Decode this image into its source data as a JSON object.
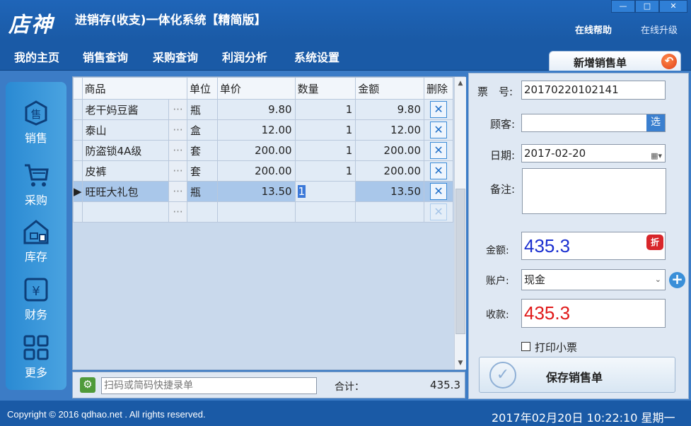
{
  "app": {
    "logo": "店神",
    "title": "进销存(收支)一体化系统【精简版】",
    "help": "在线帮助",
    "upgrade": "在线升级",
    "window_controls": {
      "minimize": "—",
      "maximize": "□",
      "close": "✕"
    }
  },
  "menu": [
    "我的主页",
    "销售查询",
    "采购查询",
    "利润分析",
    "系统设置"
  ],
  "page_tab": {
    "label": "新增销售单",
    "back_icon": "back-arrow-icon"
  },
  "sidebar": [
    {
      "label": "销售",
      "icon": "sales-icon"
    },
    {
      "label": "采购",
      "icon": "cart-icon"
    },
    {
      "label": "库存",
      "icon": "warehouse-icon"
    },
    {
      "label": "财务",
      "icon": "finance-icon"
    },
    {
      "label": "更多",
      "icon": "grid-icon"
    }
  ],
  "grid": {
    "columns": [
      "商品",
      "单位",
      "单价",
      "数量",
      "金额",
      "删除"
    ],
    "rows": [
      {
        "name": "老干妈豆酱",
        "unit": "瓶",
        "price": "9.80",
        "qty": "1",
        "amount": "9.80"
      },
      {
        "name": "泰山",
        "unit": "盒",
        "price": "12.00",
        "qty": "1",
        "amount": "12.00"
      },
      {
        "name": "防盗锁4A级",
        "unit": "套",
        "price": "200.00",
        "qty": "1",
        "amount": "200.00"
      },
      {
        "name": "皮裤",
        "unit": "套",
        "price": "200.00",
        "qty": "1",
        "amount": "200.00"
      },
      {
        "name": "旺旺大礼包",
        "unit": "瓶",
        "price": "13.50",
        "qty": "1",
        "amount": "13.50"
      }
    ],
    "selected_row": 4
  },
  "footer": {
    "scan_placeholder": "扫码或简码快捷录单",
    "total_label": "合计：",
    "total_value": "435.3"
  },
  "form": {
    "ticket_label": "票　号:",
    "ticket_value": "20170220102141",
    "customer_label": "顾客:",
    "customer_value": "",
    "pick_label": "选",
    "date_label": "日期:",
    "date_value": "2017-02-20",
    "note_label": "备注:",
    "amount_label": "金额:",
    "amount_value": "435.3",
    "discount_label": "折",
    "account_label": "账户:",
    "account_value": "现金",
    "receive_label": "收款:",
    "receive_value": "435.3",
    "print_label": "打印小票",
    "save_label": "保存销售单",
    "colors": {
      "amount": "#1a2fd0",
      "receive": "#e01818"
    }
  },
  "status": {
    "copyright": "Copyright © 2016 qdhao.net . All rights reserved.",
    "datetime": "2017年02月20日  10:22:10  星期一"
  }
}
